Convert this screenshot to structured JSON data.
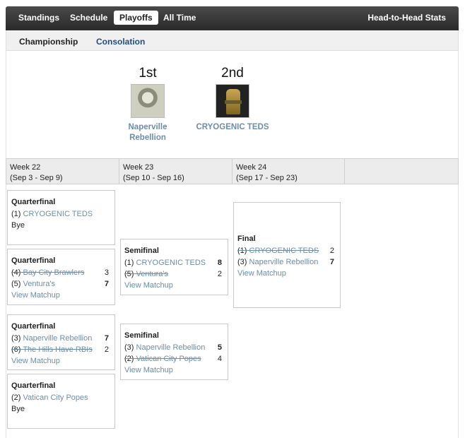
{
  "nav": {
    "tabs": [
      "Standings",
      "Schedule",
      "Playoffs",
      "All Time"
    ],
    "right_link": "Head-to-Head Stats"
  },
  "subnav": {
    "current": "Championship",
    "link": "Consolation"
  },
  "podium": {
    "first": {
      "rank": "1st",
      "name_line1": "Naperville",
      "name_line2": "Rebellion"
    },
    "second": {
      "rank": "2nd",
      "name": "CRYOGENIC TEDS"
    }
  },
  "weeks": [
    {
      "label": "Week 22",
      "dates": "(Sep 3 - Sep 9)"
    },
    {
      "label": "Week 23",
      "dates": "(Sep 10 - Sep 16)"
    },
    {
      "label": "Week 24",
      "dates": "(Sep 17 - Sep 23)"
    }
  ],
  "view_matchup": "View Matchup",
  "matches": {
    "qf1": {
      "round": "Quarterfinal",
      "seed": "(1)",
      "team": "CRYOGENIC TEDS",
      "bye": "Bye"
    },
    "qf2": {
      "round": "Quarterfinal",
      "a_seed": "(4)",
      "a_team": "Bay City Brawlers",
      "a_score": "3",
      "b_seed": "(5)",
      "b_team": "Ventura's",
      "b_score": "7"
    },
    "qf3": {
      "round": "Quarterfinal",
      "a_seed": "(3)",
      "a_team": "Naperville Rebellion",
      "a_score": "7",
      "b_seed": "(6)",
      "b_team": "The Hills Have RBIs",
      "b_score": "2"
    },
    "qf4": {
      "round": "Quarterfinal",
      "seed": "(2)",
      "team": "Vatican City Popes",
      "bye": "Bye"
    },
    "sf1": {
      "round": "Semifinal",
      "a_seed": "(1)",
      "a_team": "CRYOGENIC TEDS",
      "a_score": "8",
      "b_seed": "(5)",
      "b_team": "Ventura's",
      "b_score": "2"
    },
    "sf2": {
      "round": "Semifinal",
      "a_seed": "(3)",
      "a_team": "Naperville Rebellion",
      "a_score": "5",
      "b_seed": "(2)",
      "b_team": "Vatican City Popes",
      "b_score": "4"
    },
    "final": {
      "round": "Final",
      "a_seed": "(1)",
      "a_team": "CRYOGENIC TEDS",
      "a_score": "2",
      "b_seed": "(3)",
      "b_team": "Naperville Rebellion",
      "b_score": "7"
    }
  }
}
